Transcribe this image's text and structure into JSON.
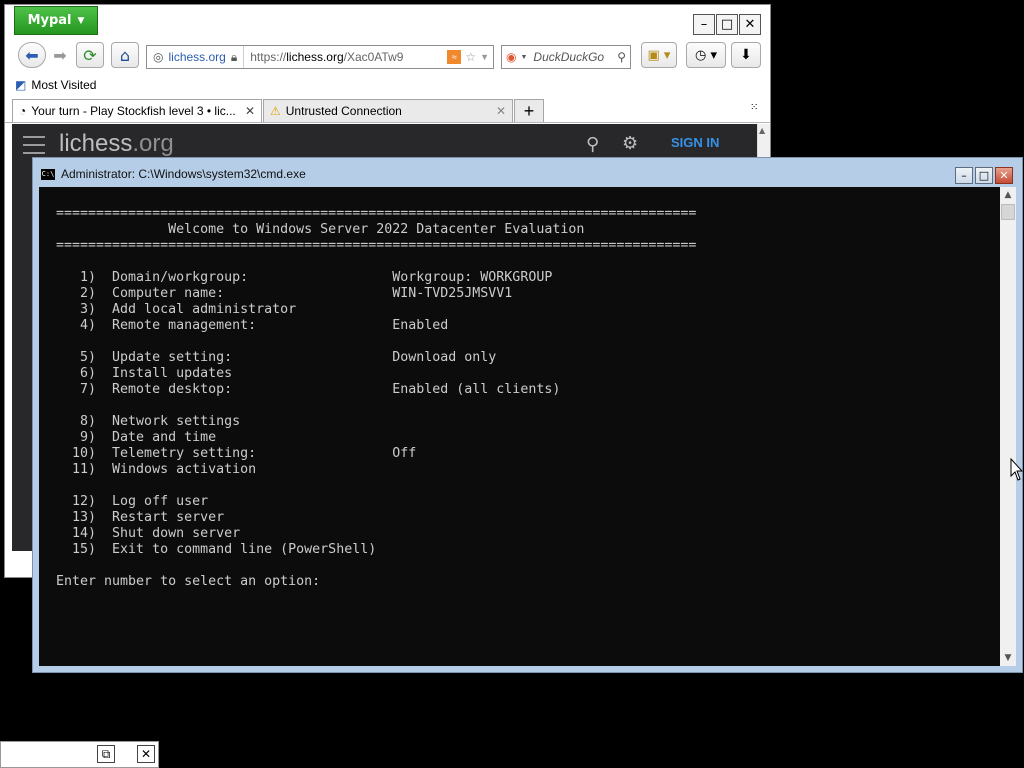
{
  "browser": {
    "app_button": "Mypal",
    "window_controls": [
      "–",
      "□",
      "✕"
    ],
    "site_identity": "lichess.org",
    "url_prefix": "https://",
    "url_host": "lichess.org",
    "url_path": "/Xac0ATw9",
    "search_engine": "DuckDuckGo",
    "bookmarks_label": "Most Visited",
    "tabs": [
      {
        "label": "Your turn - Play Stockfish level 3 • lic...",
        "active": true
      },
      {
        "label": "Untrusted Connection",
        "active": false
      }
    ],
    "new_tab": "+",
    "page": {
      "logo_main": "lichess",
      "logo_suffix": ".org",
      "sign_in": "SIGN IN"
    }
  },
  "cmd": {
    "title": "Administrator: C:\\Windows\\system32\\cmd.exe",
    "icon_text": "C:\\",
    "controls": [
      "–",
      "□",
      "✕"
    ],
    "separator": "================================================================================",
    "welcome": "Welcome to Windows Server 2022 Datacenter Evaluation",
    "menu": [
      {
        "num": "1)",
        "label": "Domain/workgroup:",
        "value": "Workgroup: WORKGROUP"
      },
      {
        "num": "2)",
        "label": "Computer name:",
        "value": "WIN-TVD25JMSVV1"
      },
      {
        "num": "3)",
        "label": "Add local administrator",
        "value": ""
      },
      {
        "num": "4)",
        "label": "Remote management:",
        "value": "Enabled"
      },
      null,
      {
        "num": "5)",
        "label": "Update setting:",
        "value": "Download only"
      },
      {
        "num": "6)",
        "label": "Install updates",
        "value": ""
      },
      {
        "num": "7)",
        "label": "Remote desktop:",
        "value": "Enabled (all clients)"
      },
      null,
      {
        "num": "8)",
        "label": "Network settings",
        "value": ""
      },
      {
        "num": "9)",
        "label": "Date and time",
        "value": ""
      },
      {
        "num": "10)",
        "label": "Telemetry setting:",
        "value": "Off"
      },
      {
        "num": "11)",
        "label": "Windows activation",
        "value": ""
      },
      null,
      {
        "num": "12)",
        "label": "Log off user",
        "value": ""
      },
      {
        "num": "13)",
        "label": "Restart server",
        "value": ""
      },
      {
        "num": "14)",
        "label": "Shut down server",
        "value": ""
      },
      {
        "num": "15)",
        "label": "Exit to command line (PowerShell)",
        "value": ""
      }
    ],
    "prompt": "Enter number to select an option:"
  },
  "taskbar_min": {
    "controls": [
      "⧉",
      "✕"
    ]
  }
}
